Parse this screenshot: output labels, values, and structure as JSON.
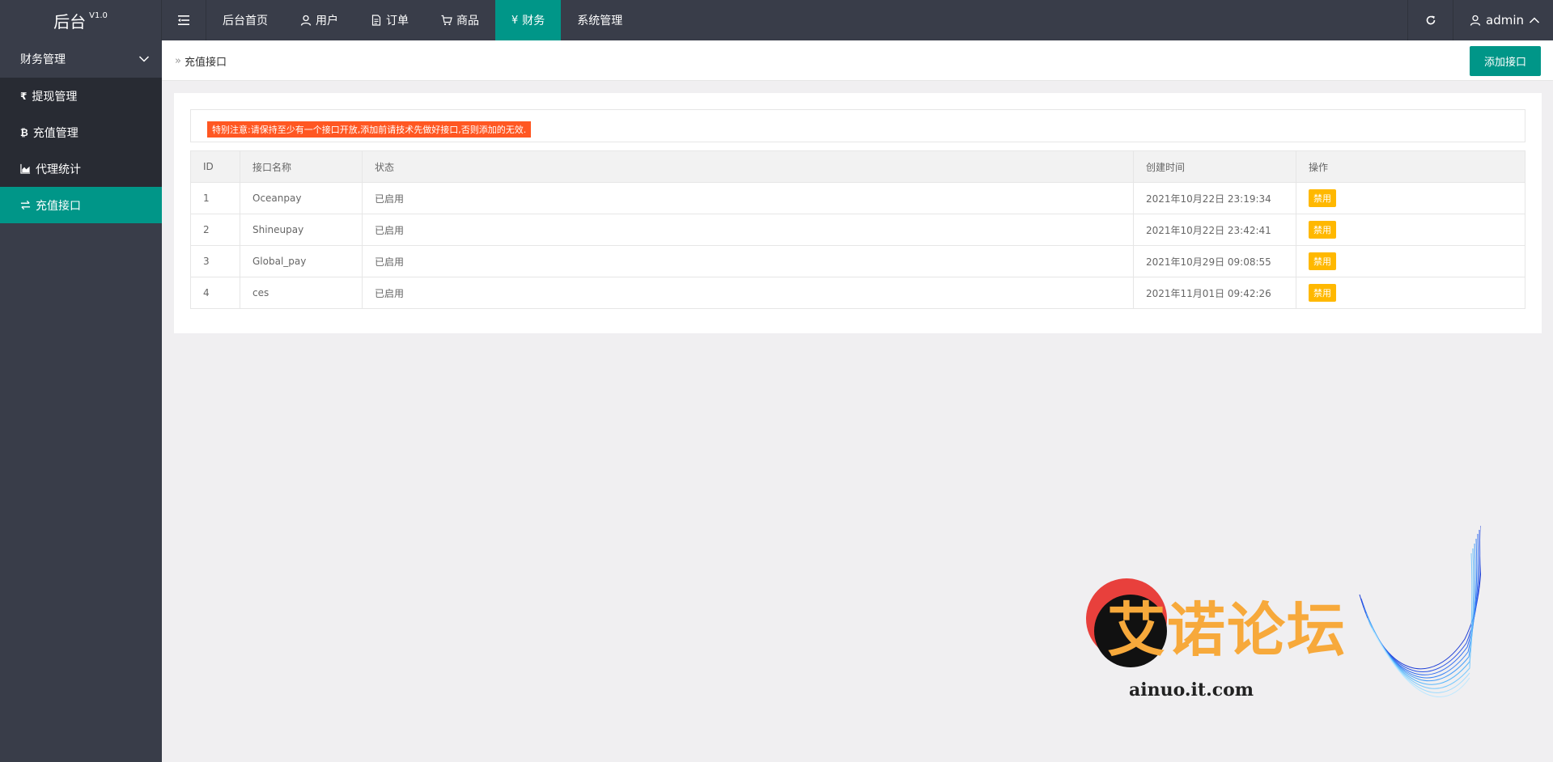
{
  "header": {
    "logo_text": "后台",
    "logo_version": "V1.0",
    "nav": [
      {
        "label": "后台首页",
        "icon": ""
      },
      {
        "label": "用户",
        "icon": "user-icon"
      },
      {
        "label": "订单",
        "icon": "document-icon"
      },
      {
        "label": "商品",
        "icon": "cart-icon"
      },
      {
        "label": "财务",
        "icon": "yen-icon"
      },
      {
        "label": "系统管理",
        "icon": ""
      }
    ],
    "active_nav": "财务",
    "user_name": "admin"
  },
  "sidebar": {
    "group_label": "财务管理",
    "items": [
      {
        "label": "提现管理",
        "icon": "rupee-icon"
      },
      {
        "label": "充值管理",
        "icon": "bitcoin-icon"
      },
      {
        "label": "代理统计",
        "icon": "area-chart-icon"
      },
      {
        "label": "充值接口",
        "icon": "exchange-icon"
      }
    ],
    "active_item": "充值接口"
  },
  "breadcrumb": {
    "current": "充值接口"
  },
  "toolbar": {
    "add_label": "添加接口"
  },
  "notice": "特别注意:请保持至少有一个接口开放,添加前请技术先做好接口,否则添加的无效.",
  "table": {
    "headers": [
      "ID",
      "接口名称",
      "状态",
      "创建时间",
      "操作"
    ],
    "rows": [
      {
        "id": "1",
        "name": "Oceanpay",
        "status": "已启用",
        "created": "2021年10月22日 23:19:34",
        "action": "禁用"
      },
      {
        "id": "2",
        "name": "Shineupay",
        "status": "已启用",
        "created": "2021年10月22日 23:42:41",
        "action": "禁用"
      },
      {
        "id": "3",
        "name": "Global_pay",
        "status": "已启用",
        "created": "2021年10月29日 09:08:55",
        "action": "禁用"
      },
      {
        "id": "4",
        "name": "ces",
        "status": "已启用",
        "created": "2021年11月01日 09:42:26",
        "action": "禁用"
      }
    ]
  },
  "watermark": {
    "title": "艾诺论坛",
    "url": "ainuo.it.com"
  },
  "colors": {
    "header_bg": "#393d49",
    "accent": "#009688",
    "notice_bg": "#ff5722",
    "badge_bg": "#ffb800",
    "status_green": "#009f00"
  }
}
